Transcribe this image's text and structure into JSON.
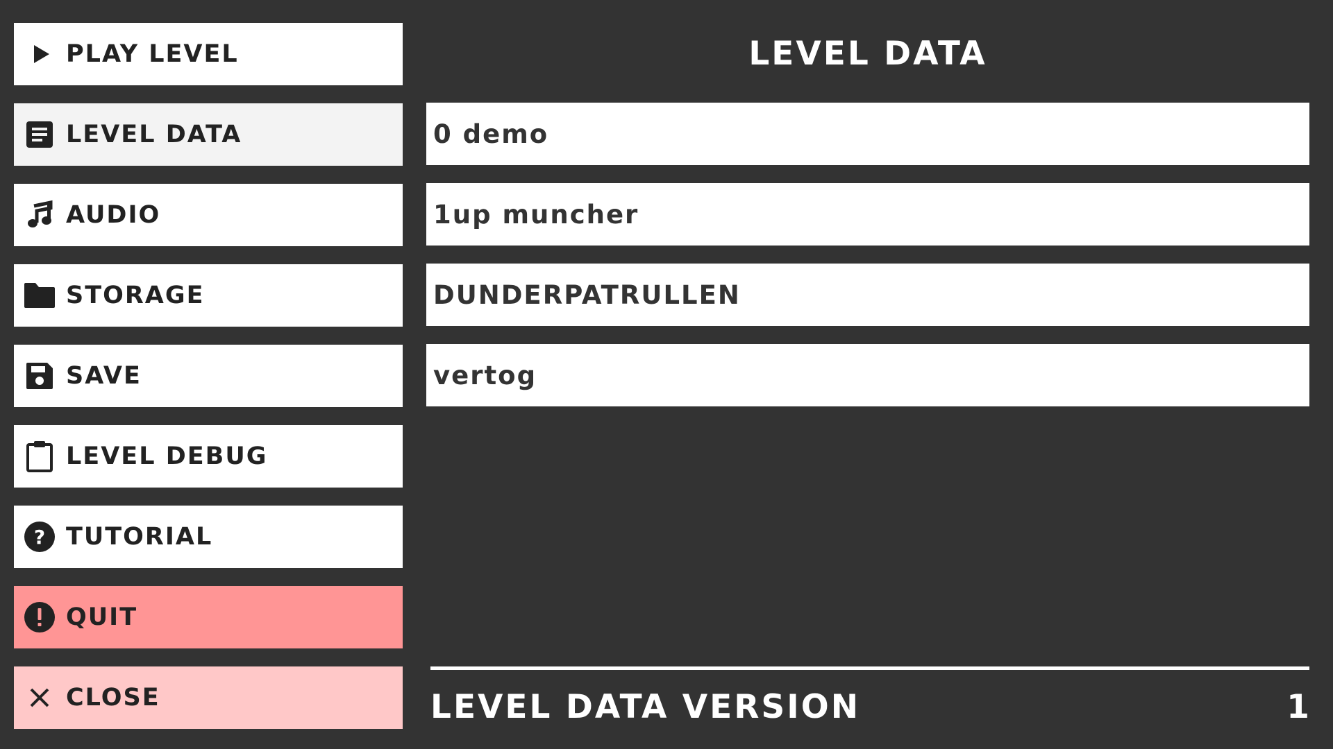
{
  "sidebar": {
    "items": [
      {
        "label": "PLAY LEVEL",
        "icon": "play-icon"
      },
      {
        "label": "LEVEL DATA",
        "icon": "document-icon",
        "active": true
      },
      {
        "label": "AUDIO",
        "icon": "music-note-icon"
      },
      {
        "label": "STORAGE",
        "icon": "folder-icon"
      },
      {
        "label": "SAVE",
        "icon": "floppy-disk-icon"
      },
      {
        "label": "LEVEL DEBUG",
        "icon": "clipboard-icon"
      },
      {
        "label": "TUTORIAL",
        "icon": "help-icon"
      },
      {
        "label": "QUIT",
        "icon": "alert-icon",
        "color": "#ff9595"
      },
      {
        "label": "CLOSE",
        "icon": "close-icon",
        "color": "#ffc8c8"
      }
    ]
  },
  "main": {
    "title": "LEVEL DATA",
    "levels": [
      "0 demo",
      "1up muncher",
      "DUNDERPATRULLEN",
      "vertog"
    ],
    "version_label": "LEVEL DATA VERSION",
    "version_value": "1"
  },
  "colors": {
    "background": "#333333",
    "button": "#ffffff",
    "active_button": "#f3f3f3",
    "quit": "#ff9595",
    "close": "#ffc8c8",
    "icon": "#222222"
  }
}
